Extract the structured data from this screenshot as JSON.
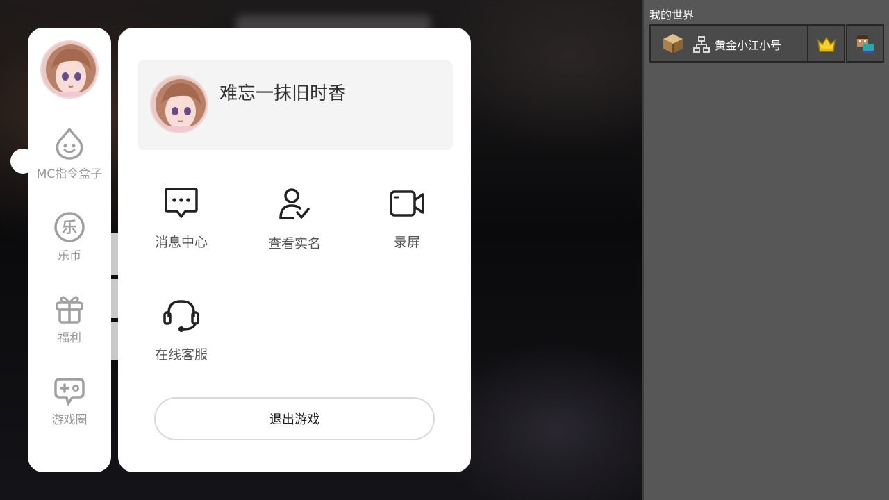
{
  "sidebar": {
    "items": [
      {
        "label": "MC指令盒子",
        "icon": "smiley-drop-icon"
      },
      {
        "label": "乐币",
        "icon": "le-coin-icon"
      },
      {
        "label": "福利",
        "icon": "gift-icon"
      },
      {
        "label": "游戏圈",
        "icon": "gamepad-icon"
      }
    ],
    "coin_glyph": "乐"
  },
  "profile": {
    "name": "难忘一抹旧时香"
  },
  "menu": {
    "tiles": [
      {
        "label": "消息中心",
        "icon": "message-icon"
      },
      {
        "label": "查看实名",
        "icon": "user-verify-icon"
      },
      {
        "label": "录屏",
        "icon": "video-record-icon"
      },
      {
        "label": "在线客服",
        "icon": "headset-icon"
      }
    ],
    "exit_label": "退出游戏"
  },
  "world": {
    "title": "我的世界",
    "server_name": "黄金小江小号"
  },
  "colors": {
    "panel_bg": "#ffffff",
    "card_bg": "#f4f4f4",
    "label_gray": "#9a9a9a",
    "world_panel_bg": "#575757",
    "crown_yellow": "#f5d130"
  }
}
